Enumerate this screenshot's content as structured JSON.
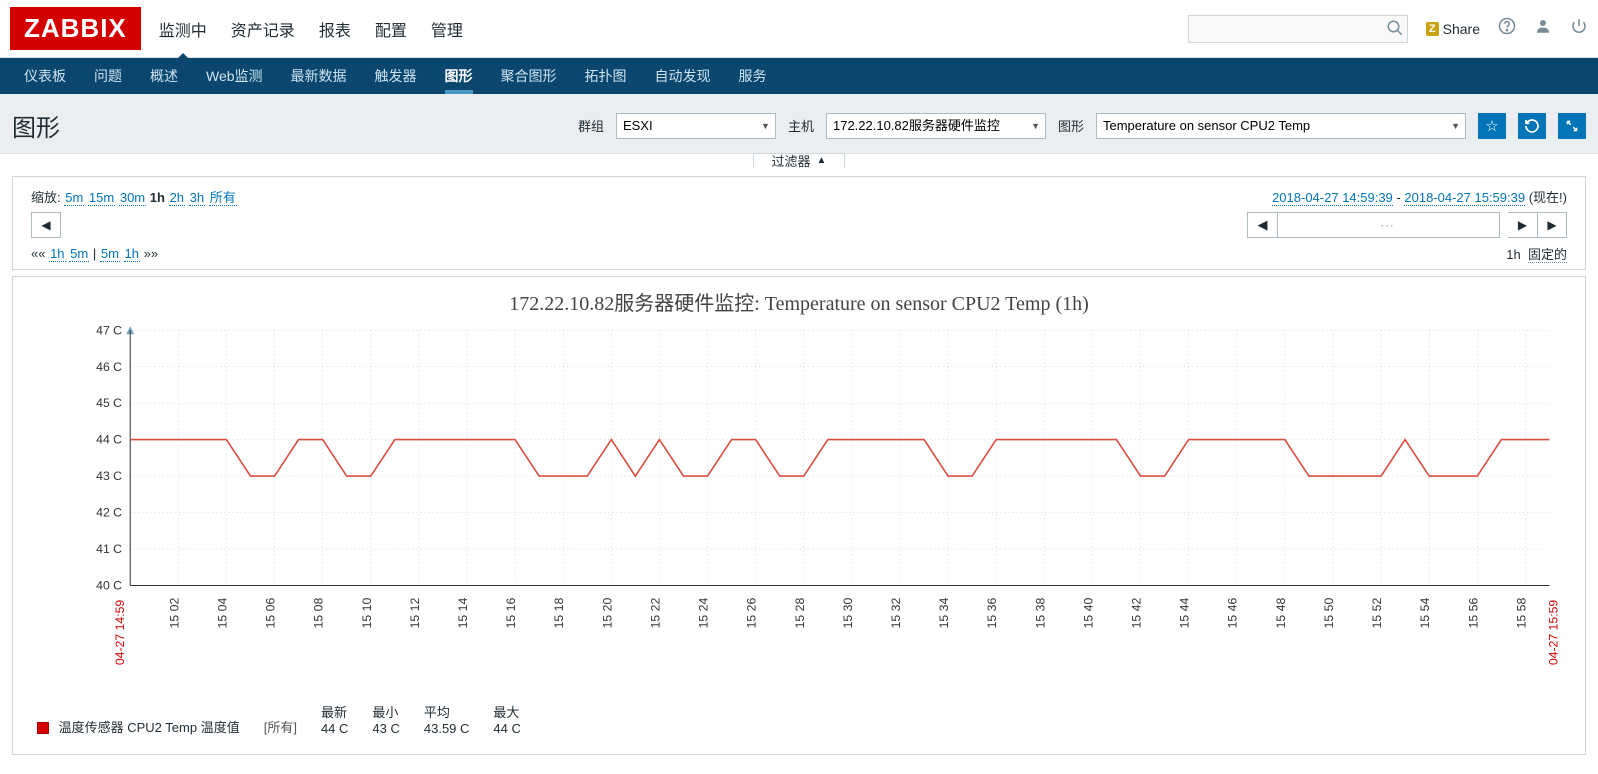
{
  "brand": "ZABBIX",
  "mainNav": [
    "监测中",
    "资产记录",
    "报表",
    "配置",
    "管理"
  ],
  "mainNavActive": 0,
  "subNav": [
    "仪表板",
    "问题",
    "概述",
    "Web监测",
    "最新数据",
    "触发器",
    "图形",
    "聚合图形",
    "拓扑图",
    "自动发现",
    "服务"
  ],
  "subNavActive": 6,
  "share": "Share",
  "pageTitle": "图形",
  "controls": {
    "groupLabel": "群组",
    "groupValue": "ESXI",
    "hostLabel": "主机",
    "hostValue": "172.22.10.82服务器硬件监控",
    "graphLabel": "图形",
    "graphValue": "Temperature on sensor CPU2 Temp"
  },
  "filterTab": "过滤器",
  "zoom": {
    "label": "缩放:",
    "options": [
      "5m",
      "15m",
      "30m",
      "1h",
      "2h",
      "3h",
      "所有"
    ],
    "current": "1h"
  },
  "timeRange": {
    "from": "2018-04-27 14:59:39",
    "to": "2018-04-27 15:59:39",
    "nowLabel": "(现在!)"
  },
  "stepLine": {
    "leftDoubleArrow": "««",
    "left": [
      "1h",
      "5m"
    ],
    "mid": "|",
    "right": [
      "5m",
      "1h"
    ],
    "rightDoubleArrow": "»»"
  },
  "fixed": {
    "duration": "1h",
    "label": "固定的"
  },
  "chart_data": {
    "type": "line",
    "title": "172.22.10.82服务器硬件监控: Temperature on sensor CPU2 Temp (1h)",
    "ylabel": "",
    "ylim": [
      40,
      47
    ],
    "yticks": [
      "40 C",
      "41 C",
      "42 C",
      "43 C",
      "44 C",
      "45 C",
      "46 C",
      "47 C"
    ],
    "xticks": [
      "15 02",
      "15 04",
      "15 06",
      "15 08",
      "15 10",
      "15 12",
      "15 14",
      "15 16",
      "15 18",
      "15 20",
      "15 22",
      "15 24",
      "15 26",
      "15 28",
      "15 30",
      "15 32",
      "15 34",
      "15 36",
      "15 38",
      "15 40",
      "15 42",
      "15 44",
      "15 46",
      "15 48",
      "15 50",
      "15 52",
      "15 54",
      "15 56",
      "15 58"
    ],
    "startLabel": "04-27 14:59",
    "endLabel": "04-27 15:59",
    "series": [
      {
        "name": "温度传感器 CPU2 Temp 温度值",
        "color": "#dc4e41",
        "x": [
          0,
          1,
          2,
          3,
          4,
          5,
          6,
          7,
          8,
          9,
          10,
          11,
          12,
          13,
          14,
          15,
          16,
          17,
          18,
          19,
          20,
          21,
          22,
          23,
          24,
          25,
          26,
          27,
          28,
          29,
          30,
          31,
          32,
          33,
          34,
          35,
          36,
          37,
          38,
          39,
          40,
          41,
          42,
          43,
          44,
          45,
          46,
          47,
          48,
          49,
          50,
          51,
          52,
          53,
          54,
          55,
          56,
          57,
          58,
          59
        ],
        "values": [
          44,
          44,
          44,
          44,
          44,
          43,
          43,
          44,
          44,
          43,
          43,
          44,
          44,
          44,
          44,
          44,
          44,
          43,
          43,
          43,
          44,
          43,
          44,
          43,
          43,
          44,
          44,
          43,
          43,
          44,
          44,
          44,
          44,
          44,
          43,
          43,
          44,
          44,
          44,
          44,
          44,
          44,
          43,
          43,
          44,
          44,
          44,
          44,
          44,
          43,
          43,
          43,
          43,
          44,
          43,
          43,
          43,
          44,
          44,
          44
        ]
      }
    ]
  },
  "legend": {
    "series": "温度传感器 CPU2 Temp 温度值",
    "func": "[所有]",
    "stats": [
      {
        "hdr": "最新",
        "val": "44 C"
      },
      {
        "hdr": "最小",
        "val": "43 C"
      },
      {
        "hdr": "平均",
        "val": "43.59 C"
      },
      {
        "hdr": "最大",
        "val": "44 C"
      }
    ]
  }
}
